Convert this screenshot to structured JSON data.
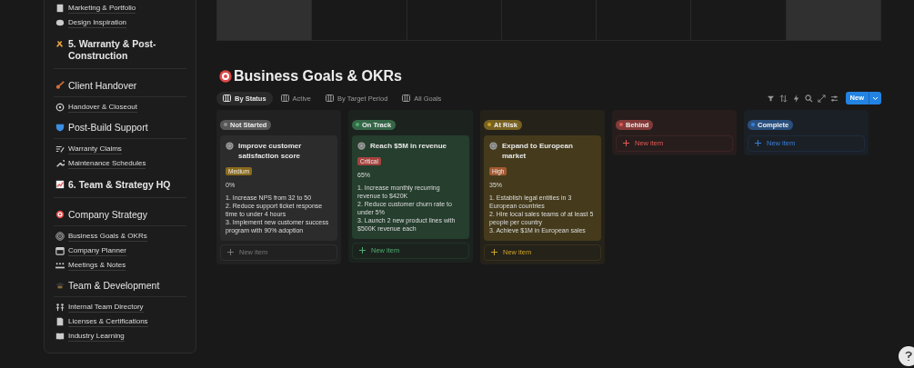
{
  "calendar_cells": [
    {
      "kind": "weekend"
    },
    {
      "kind": "weekday"
    },
    {
      "kind": "weekday"
    },
    {
      "kind": "weekday"
    },
    {
      "kind": "weekday"
    },
    {
      "kind": "weekday"
    },
    {
      "kind": "weekend"
    }
  ],
  "sidebar": [
    {
      "kind": "item",
      "label": "Marketing & Portfolio"
    },
    {
      "kind": "item",
      "label": "Design Inspiration"
    },
    {
      "kind": "heading",
      "label": "5. Warranty & Post-Construction"
    },
    {
      "kind": "subheading",
      "label": "Client Handover"
    },
    {
      "kind": "item",
      "label": "Handover & Closeout"
    },
    {
      "kind": "subheading",
      "label": "Post-Build Support"
    },
    {
      "kind": "item",
      "label": "Warranty Claims"
    },
    {
      "kind": "item",
      "label": "Maintenance Schedules"
    },
    {
      "kind": "heading",
      "label": "6. Team & Strategy HQ"
    },
    {
      "kind": "subheading",
      "label": "Company Strategy"
    },
    {
      "kind": "item",
      "label": "Business Goals & OKRs"
    },
    {
      "kind": "item",
      "label": "Company Planner"
    },
    {
      "kind": "item",
      "label": "Meetings & Notes"
    },
    {
      "kind": "subheading",
      "label": "Team & Development"
    },
    {
      "kind": "item",
      "label": "Internal Team Directory"
    },
    {
      "kind": "item",
      "label": "Licenses & Certifications"
    },
    {
      "kind": "item",
      "label": "Industry Learning"
    }
  ],
  "page_title": "Business Goals & OKRs",
  "views": [
    {
      "label": "By Status",
      "selected": true
    },
    {
      "label": "Active",
      "selected": false
    },
    {
      "label": "By Target Period",
      "selected": false
    },
    {
      "label": "All Goals",
      "selected": false
    }
  ],
  "new_button": "New",
  "columns": [
    {
      "status": "Not Started",
      "color": "#8e8e8e",
      "new_item": "New item",
      "cards": [
        {
          "title": "Improve customer satisfaction score",
          "priority": {
            "label": "Medium",
            "color": "#8a6a1c"
          },
          "progress": "0%",
          "objectives": [
            "1. Increase NPS from 32 to 50",
            "2. Reduce support ticket response time to under 4 hours",
            "3. Implement new customer success program with 90% adoption"
          ]
        }
      ]
    },
    {
      "status": "On Track",
      "color": "#4dab6f",
      "new_item": "New item",
      "cards": [
        {
          "title": "Reach $5M in revenue",
          "priority": {
            "label": "Critical",
            "color": "#a6433e"
          },
          "progress": "65%",
          "objectives": [
            "1. Increase monthly recurring revenue to $420K",
            "2. Reduce customer churn rate to under 5%",
            "3. Launch 2 new product lines with $500K revenue each"
          ]
        }
      ]
    },
    {
      "status": "At Risk",
      "color": "#c9a227",
      "new_item": "New item",
      "cards": [
        {
          "title": "Expand to European market",
          "priority": {
            "label": "High",
            "color": "#a35a32"
          },
          "progress": "35%",
          "objectives": [
            "1. Establish legal entities in 3 European countries",
            "2. Hire local sales teams of at least 5 people per country",
            "3. Achieve $1M in European sales"
          ]
        }
      ]
    },
    {
      "status": "Behind",
      "color": "#e05a55",
      "new_item": "New item"
    },
    {
      "status": "Complete",
      "color": "#3a7fd5",
      "new_item": "New item"
    }
  ]
}
